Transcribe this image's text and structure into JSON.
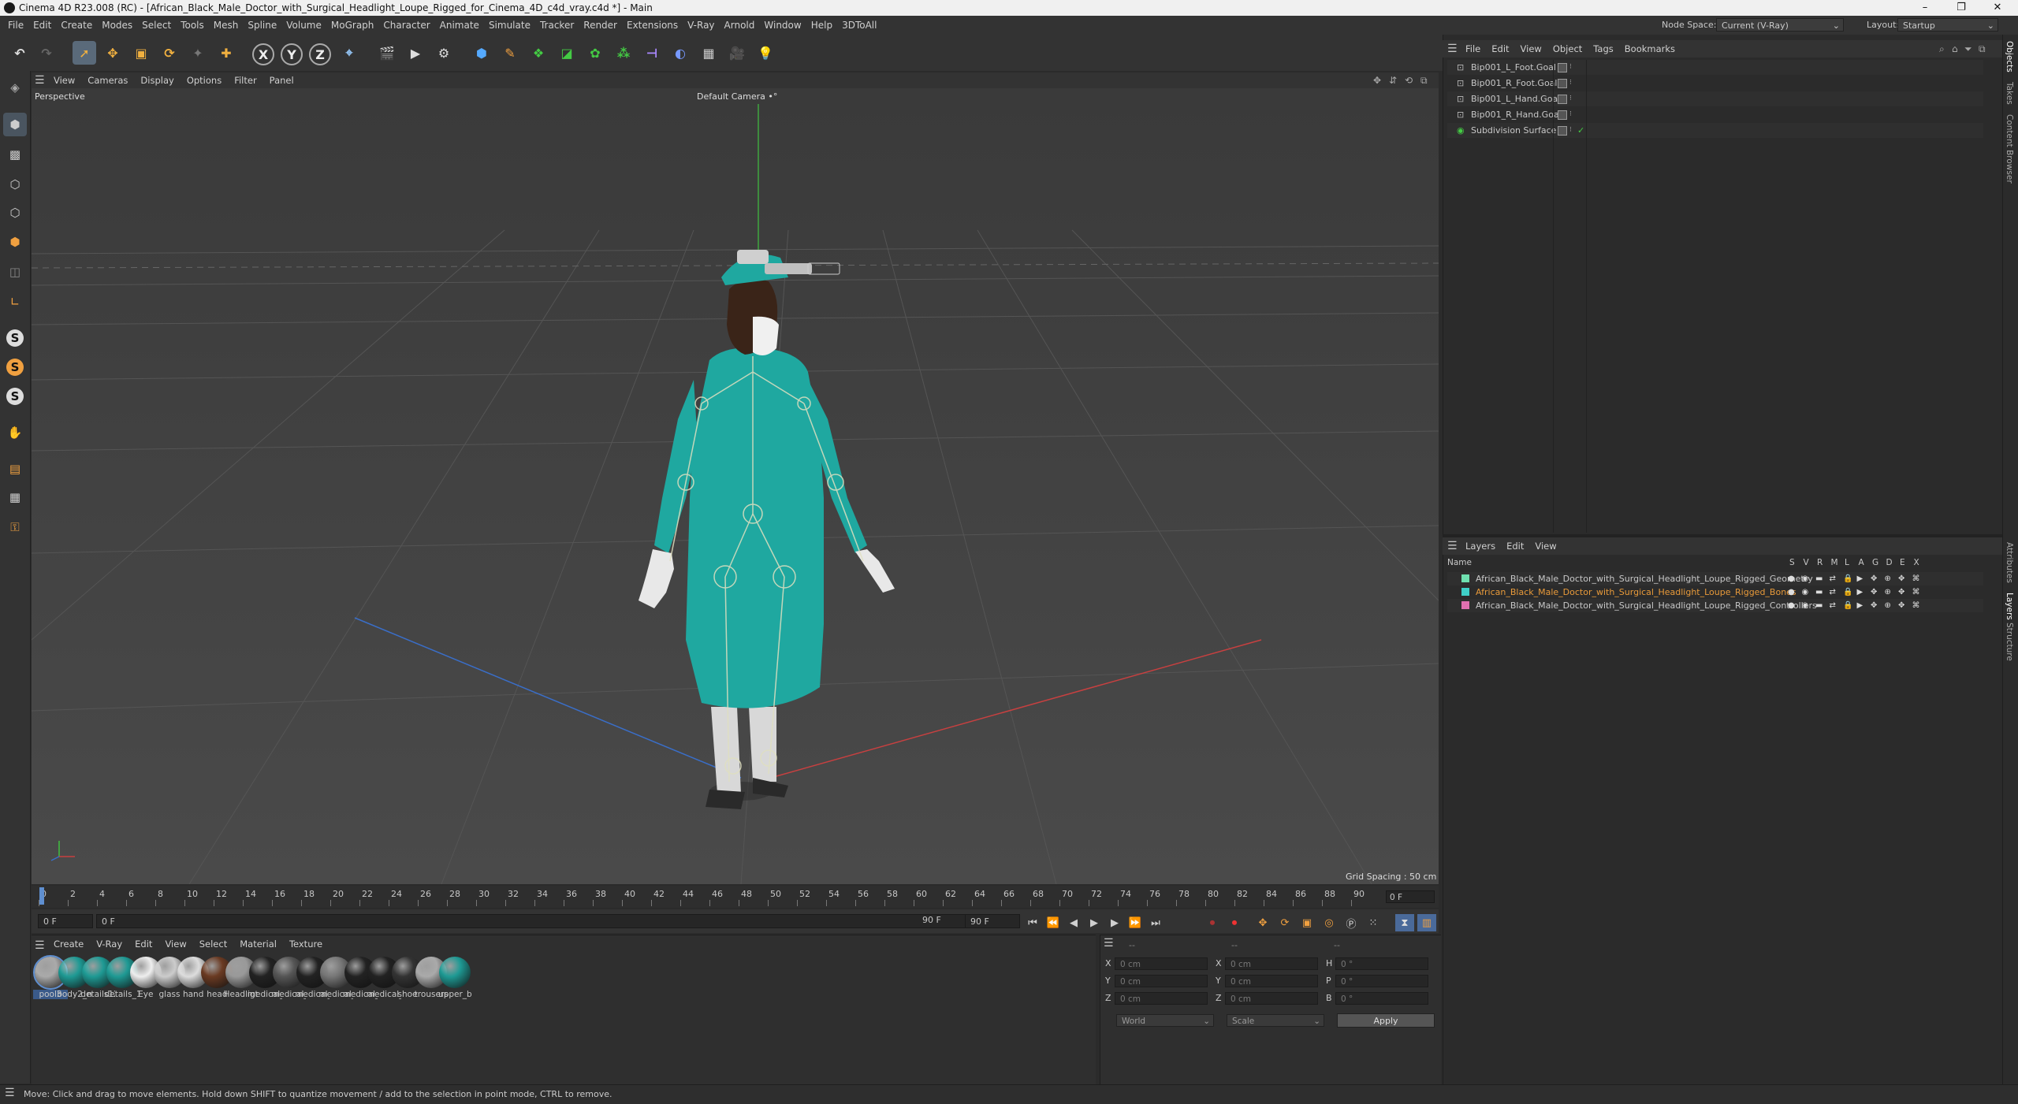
{
  "window": {
    "title": "Cinema 4D R23.008 (RC) - [African_Black_Male_Doctor_with_Surgical_Headlight_Loupe_Rigged_for_Cinema_4D_c4d_vray.c4d *] - Main",
    "controls": [
      "–",
      "❐",
      "✕"
    ]
  },
  "menu": [
    "File",
    "Edit",
    "Create",
    "Modes",
    "Select",
    "Tools",
    "Mesh",
    "Spline",
    "Volume",
    "MoGraph",
    "Character",
    "Animate",
    "Simulate",
    "Tracker",
    "Render",
    "Extensions",
    "V-Ray",
    "Arnold",
    "Window",
    "Help",
    "3DToAll"
  ],
  "node_space": {
    "label": "Node Space:",
    "value": "Current (V-Ray)"
  },
  "layout": {
    "label": "Layout:",
    "value": "Startup"
  },
  "viewport": {
    "menu": [
      "View",
      "Cameras",
      "Display",
      "Options",
      "Filter",
      "Panel"
    ],
    "label": "Perspective",
    "camera": "Default Camera •°",
    "grid_spacing": "Grid Spacing : 50 cm"
  },
  "timeline": {
    "ticks": [
      "0",
      "2",
      "4",
      "6",
      "8",
      "10",
      "12",
      "14",
      "16",
      "18",
      "20",
      "22",
      "24",
      "26",
      "28",
      "30",
      "32",
      "34",
      "36",
      "38",
      "40",
      "42",
      "44",
      "46",
      "48",
      "50",
      "52",
      "54",
      "56",
      "58",
      "60",
      "62",
      "64",
      "66",
      "68",
      "70",
      "72",
      "74",
      "76",
      "78",
      "80",
      "82",
      "84",
      "86",
      "88",
      "90"
    ],
    "current_frame": "0 F"
  },
  "transport": {
    "start": "0 F",
    "current": "0 F",
    "end": "90 F",
    "end2": "90 F"
  },
  "material_panel": {
    "menu": [
      "Create",
      "V-Ray",
      "Edit",
      "View",
      "Select",
      "Material",
      "Texture"
    ],
    "materials": [
      {
        "label": "pool3"
      },
      {
        "label": "body2_n"
      },
      {
        "label": "details12"
      },
      {
        "label": "details_1"
      },
      {
        "label": "Eye"
      },
      {
        "label": "glass"
      },
      {
        "label": "hand"
      },
      {
        "label": "head"
      },
      {
        "label": "Headligt"
      },
      {
        "label": "medical_"
      },
      {
        "label": "medical_"
      },
      {
        "label": "medical_"
      },
      {
        "label": "medical_"
      },
      {
        "label": "medical_"
      },
      {
        "label": "medical_"
      },
      {
        "label": "shoe"
      },
      {
        "label": "trousers"
      },
      {
        "label": "upper_b"
      }
    ]
  },
  "coordinates": {
    "header": "--",
    "col1_header": "--",
    "col2_header": "--",
    "rows": [
      {
        "a": "X",
        "av": "0 cm",
        "b": "X",
        "bv": "0 cm",
        "c": "H",
        "cv": "0 °"
      },
      {
        "a": "Y",
        "av": "0 cm",
        "b": "Y",
        "bv": "0 cm",
        "c": "P",
        "cv": "0 °"
      },
      {
        "a": "Z",
        "av": "0 cm",
        "b": "Z",
        "bv": "0 cm",
        "c": "B",
        "cv": "0 °"
      }
    ],
    "mode1": "World",
    "mode2": "Scale",
    "apply": "Apply"
  },
  "objects_panel": {
    "menu": [
      "File",
      "Edit",
      "View",
      "Object",
      "Tags",
      "Bookmarks"
    ],
    "items": [
      "Bip001_L_Foot.Goal",
      "Bip001_R_Foot.Goal",
      "Bip001_L_Hand.Goal",
      "Bip001_R_Hand.Goal",
      "Subdivision Surface"
    ]
  },
  "layers_panel": {
    "menu": [
      "Layers",
      "Edit",
      "View"
    ],
    "name_header": "Name",
    "flags": [
      "S",
      "V",
      "R",
      "M",
      "L",
      "A",
      "G",
      "D",
      "E",
      "X"
    ],
    "layers": [
      {
        "name": "African_Black_Male_Doctor_with_Surgical_Headlight_Loupe_Rigged_Geometry",
        "color": "#6fe0b0",
        "text_color": "#c8c8c8"
      },
      {
        "name": "African_Black_Male_Doctor_with_Surgical_Headlight_Loupe_Rigged_Bones",
        "color": "#3fd0c8",
        "text_color": "#e89a3a"
      },
      {
        "name": "African_Black_Male_Doctor_with_Surgical_Headlight_Loupe_Rigged_Controllers",
        "color": "#e070b0",
        "text_color": "#c8c8c8"
      }
    ]
  },
  "side_tabs": [
    "Objects",
    "Takes",
    "Content Browser",
    "Attributes",
    "Layers",
    "Structure"
  ],
  "status": "Move: Click and drag to move elements. Hold down SHIFT to quantize movement / add to the selection in point mode, CTRL to remove."
}
